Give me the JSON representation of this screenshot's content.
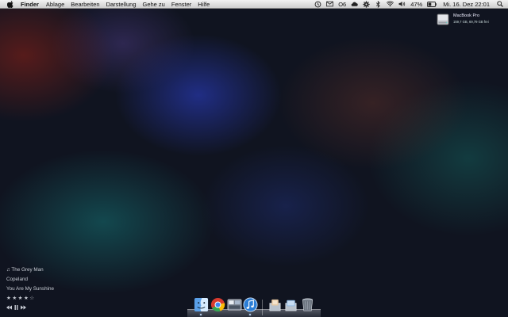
{
  "menubar": {
    "app_name": "Finder",
    "menus": [
      "Ablage",
      "Bearbeiten",
      "Darstellung",
      "Gehe zu",
      "Fenster",
      "Hilfe"
    ],
    "status_text": "O6",
    "battery_percent": "47%",
    "clock": "Mi. 16. Dez  22:01",
    "status_icons": [
      "time-machine-icon",
      "mail-icon",
      "cloud-icon",
      "gear-icon",
      "bluetooth-icon",
      "wifi-icon",
      "volume-icon",
      "battery-icon",
      "spotlight-search-icon"
    ]
  },
  "desktop": {
    "drive_name": "MacBook Pro",
    "drive_stats": "159,7 GB, 69,79 GB frei"
  },
  "now_playing": {
    "track": "♫ The Grey Man",
    "artist": "Copeland",
    "album": "You Are My Sunshine",
    "stars": "★★★★☆",
    "rating": 4,
    "rating_max": 5
  },
  "dock": {
    "items": [
      "finder-icon",
      "chrome-icon",
      "dashboard-icon",
      "itunes-icon",
      "downloads-stack-icon",
      "documents-stack-icon",
      "trash-icon"
    ]
  }
}
